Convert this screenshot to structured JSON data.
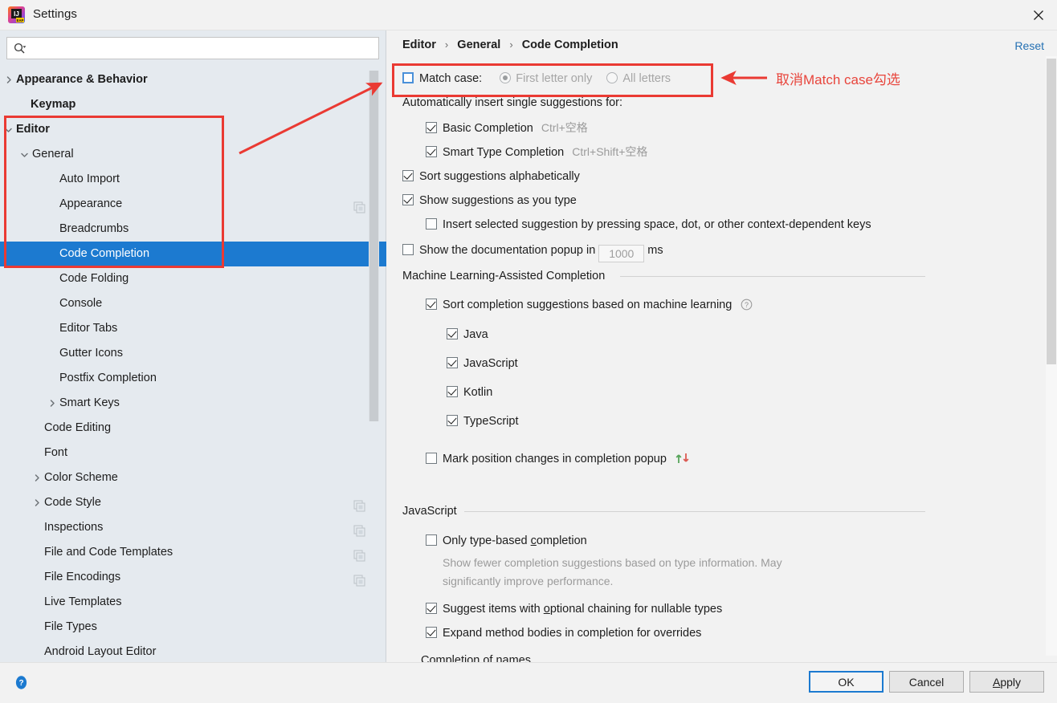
{
  "window": {
    "title": "Settings",
    "app_icon": "intellij-idea-eap-icon",
    "close_icon": "close-icon"
  },
  "search": {
    "value": "",
    "placeholder": "",
    "icon": "search-icon"
  },
  "sidebar": {
    "items": [
      {
        "label": "Appearance & Behavior",
        "indent": 20,
        "twisty": "chevron-right",
        "bold": true,
        "selected": false,
        "copy": false
      },
      {
        "label": "Keymap",
        "indent": 38,
        "twisty": "",
        "bold": true,
        "selected": false,
        "copy": false
      },
      {
        "label": "Editor",
        "indent": 20,
        "twisty": "chevron-down",
        "bold": true,
        "selected": false,
        "copy": false
      },
      {
        "label": "General",
        "indent": 40,
        "twisty": "chevron-down",
        "bold": false,
        "selected": false,
        "copy": false
      },
      {
        "label": "Auto Import",
        "indent": 74,
        "twisty": "",
        "bold": false,
        "selected": false,
        "copy": false
      },
      {
        "label": "Appearance",
        "indent": 74,
        "twisty": "",
        "bold": false,
        "selected": false,
        "copy": true
      },
      {
        "label": "Breadcrumbs",
        "indent": 74,
        "twisty": "",
        "bold": false,
        "selected": false,
        "copy": false
      },
      {
        "label": "Code Completion",
        "indent": 74,
        "twisty": "",
        "bold": false,
        "selected": true,
        "copy": false
      },
      {
        "label": "Code Folding",
        "indent": 74,
        "twisty": "",
        "bold": false,
        "selected": false,
        "copy": false
      },
      {
        "label": "Console",
        "indent": 74,
        "twisty": "",
        "bold": false,
        "selected": false,
        "copy": false
      },
      {
        "label": "Editor Tabs",
        "indent": 74,
        "twisty": "",
        "bold": false,
        "selected": false,
        "copy": false
      },
      {
        "label": "Gutter Icons",
        "indent": 74,
        "twisty": "",
        "bold": false,
        "selected": false,
        "copy": false
      },
      {
        "label": "Postfix Completion",
        "indent": 74,
        "twisty": "",
        "bold": false,
        "selected": false,
        "copy": false
      },
      {
        "label": "Smart Keys",
        "indent": 74,
        "twisty": "chevron-right",
        "bold": false,
        "selected": false,
        "copy": false
      },
      {
        "label": "Code Editing",
        "indent": 55,
        "twisty": "",
        "bold": false,
        "selected": false,
        "copy": false
      },
      {
        "label": "Font",
        "indent": 55,
        "twisty": "",
        "bold": false,
        "selected": false,
        "copy": false
      },
      {
        "label": "Color Scheme",
        "indent": 55,
        "twisty": "chevron-right",
        "bold": false,
        "selected": false,
        "copy": false
      },
      {
        "label": "Code Style",
        "indent": 55,
        "twisty": "chevron-right",
        "bold": false,
        "selected": false,
        "copy": true
      },
      {
        "label": "Inspections",
        "indent": 55,
        "twisty": "",
        "bold": false,
        "selected": false,
        "copy": true
      },
      {
        "label": "File and Code Templates",
        "indent": 55,
        "twisty": "",
        "bold": false,
        "selected": false,
        "copy": true
      },
      {
        "label": "File Encodings",
        "indent": 55,
        "twisty": "",
        "bold": false,
        "selected": false,
        "copy": true
      },
      {
        "label": "Live Templates",
        "indent": 55,
        "twisty": "",
        "bold": false,
        "selected": false,
        "copy": false
      },
      {
        "label": "File Types",
        "indent": 55,
        "twisty": "",
        "bold": false,
        "selected": false,
        "copy": false
      },
      {
        "label": "Android Layout Editor",
        "indent": 55,
        "twisty": "",
        "bold": false,
        "selected": false,
        "copy": false
      }
    ]
  },
  "main": {
    "breadcrumb": [
      "Editor",
      "General",
      "Code Completion"
    ],
    "breadcrumb_separator": "›",
    "reset_label": "Reset",
    "match_case": {
      "label": "Match case:",
      "checked": false,
      "options": [
        {
          "label": "First letter only",
          "selected": true,
          "disabled": true
        },
        {
          "label": "All letters",
          "selected": false,
          "disabled": true
        }
      ]
    },
    "auto_insert_header": "Automatically insert single suggestions for:",
    "auto_insert_items": [
      {
        "label": "Basic Completion",
        "checked": true,
        "shortcut": "Ctrl+空格"
      },
      {
        "label": "Smart Type Completion",
        "checked": true,
        "shortcut": "Ctrl+Shift+空格"
      }
    ],
    "sort_alpha": {
      "label": "Sort suggestions alphabetically",
      "checked": true
    },
    "show_as_type": {
      "label": "Show suggestions as you type",
      "checked": true
    },
    "insert_selected": {
      "label": "Insert selected suggestion by pressing space, dot, or other context-dependent keys",
      "checked": false
    },
    "doc_popup": {
      "label_before": "Show the documentation popup in",
      "value": "1000",
      "label_after": "ms",
      "checked": false
    },
    "ml_section": {
      "title": "Machine Learning-Assisted Completion",
      "sort_ml": {
        "label": "Sort completion suggestions based on machine learning",
        "checked": true,
        "help_icon": "question-circle-icon"
      },
      "languages": [
        {
          "label": "Java",
          "checked": true
        },
        {
          "label": "JavaScript",
          "checked": true
        },
        {
          "label": "Kotlin",
          "checked": true
        },
        {
          "label": "TypeScript",
          "checked": true
        }
      ],
      "mark_position": {
        "label": "Mark position changes in completion popup",
        "checked": false,
        "icons": "up-down-arrows-icon"
      }
    },
    "js_section": {
      "title": "JavaScript",
      "only_type_based": {
        "label_pre": "Only type-based ",
        "mnemonic": "c",
        "label_post": "ompletion",
        "checked": false
      },
      "only_type_based_desc_1": "Show fewer completion suggestions based on type information. May",
      "only_type_based_desc_2": "significantly improve performance.",
      "optional_chaining": {
        "label_pre": "Suggest items with ",
        "mnemonic": "o",
        "label_post": "ptional chaining for nullable types",
        "checked": true
      },
      "expand_method": {
        "label": "Expand method bodies in completion for overrides",
        "checked": true
      },
      "completion_of_names": "Completion of names"
    }
  },
  "footer": {
    "help_icon": "help-circle-icon",
    "ok_label": "OK",
    "cancel_label": "Cancel",
    "apply_label_pre": "",
    "apply_mnemonic": "A",
    "apply_label_post": "pply"
  },
  "annotations": {
    "note_text": "取消Match case勾选",
    "color": "#ea3a33"
  }
}
